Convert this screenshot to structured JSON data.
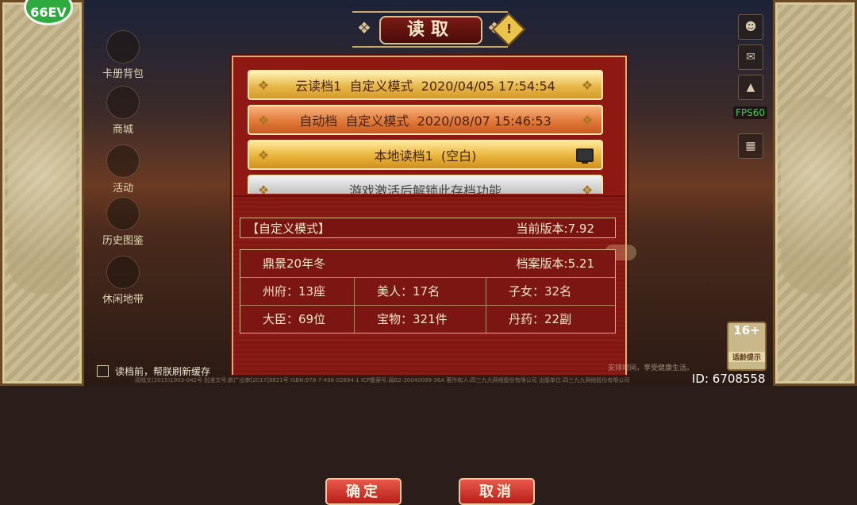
{
  "title": "读取",
  "side_menu": [
    {
      "label": "卡册背包",
      "icon": "backpack-icon"
    },
    {
      "label": "商城",
      "icon": "shop-icon"
    },
    {
      "label": "活动",
      "icon": "activity-icon"
    },
    {
      "label": "历史图鉴",
      "icon": "book-icon"
    },
    {
      "label": "休闲地带",
      "icon": "leisure-icon"
    }
  ],
  "right_icons": [
    "portrait-icon",
    "mail-icon",
    "speaker-icon",
    "gift-icon"
  ],
  "fps": "FPS60",
  "save_slots": [
    {
      "label": "云读档1  自定义模式  2020/04/05 17:54:54"
    },
    {
      "label": "自动档  自定义模式  2020/08/07 15:46:53"
    },
    {
      "label": "本地读档1  (空白)"
    },
    {
      "label": "游戏激活后解锁此存档功能"
    }
  ],
  "info": {
    "mode": "【自定义模式】",
    "current_version": "当前版本:7.92",
    "era": "鼎景20年冬",
    "archive_version": "档案版本:5.21",
    "stats": [
      [
        "州府：13座",
        "美人：17名",
        "子女：32名"
      ],
      [
        "大臣：69位",
        "宝物：321件",
        "丹药：22副"
      ]
    ]
  },
  "buttons": {
    "confirm": "确定",
    "cancel": "取消"
  },
  "checkbox_label": "读档前，帮朕刷新缓存",
  "uid": "ID: 6708558",
  "age_rating": {
    "rating": "16+",
    "label": "适龄提示"
  },
  "fine_print": "阅戏文(2015)1993-042号  批准文号:新广出审[2017]9821号  ISBN:978-7-498-02694-1  ICP备案号:闽B2-20040099-36A  著作权人:四三九九网络股份有限公司  出版单位:四三九九网络股份有限公司",
  "notice_fragment": "安排时间，享受健康生活。",
  "logo_text": "66EV"
}
